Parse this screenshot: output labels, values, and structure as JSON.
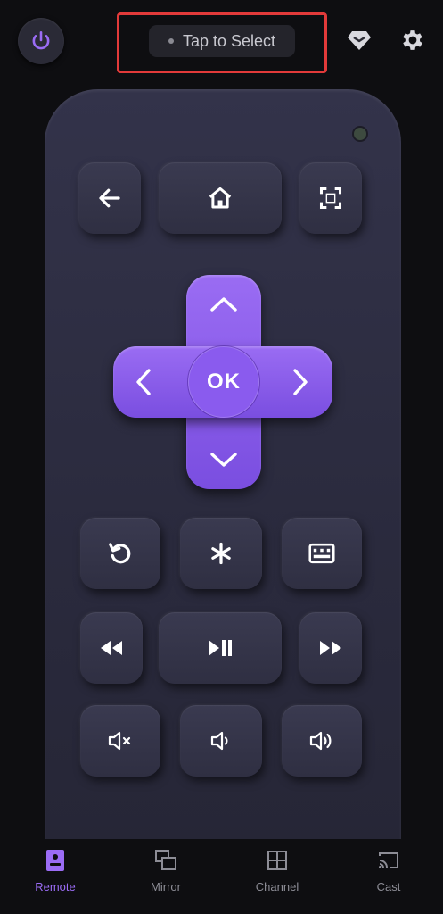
{
  "header": {
    "select_label": "Tap to Select"
  },
  "icons": {
    "power": "power-icon",
    "premium": "diamond-icon",
    "settings": "gear-icon"
  },
  "remote": {
    "dpad_center_label": "OK",
    "accent_color": "#8a5bee"
  },
  "bottom_nav": {
    "items": [
      {
        "label": "Remote",
        "icon": "remote-icon",
        "active": true
      },
      {
        "label": "Mirror",
        "icon": "mirror-icon",
        "active": false
      },
      {
        "label": "Channel",
        "icon": "channel-grid-icon",
        "active": false
      },
      {
        "label": "Cast",
        "icon": "cast-icon",
        "active": false
      }
    ]
  }
}
